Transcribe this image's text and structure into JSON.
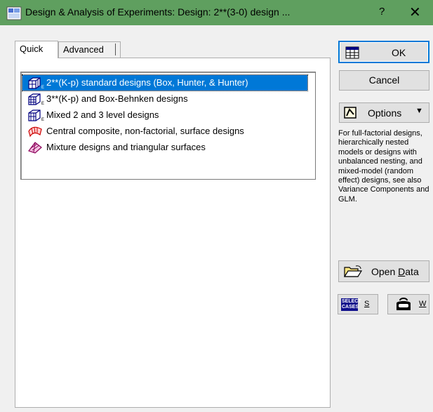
{
  "window": {
    "title": "Design & Analysis of Experiments: Design: 2**(3-0) design ...",
    "help": "?",
    "close": "✕"
  },
  "tabs": [
    {
      "label": "Quick",
      "active": true
    },
    {
      "label": "Advanced",
      "active": false
    }
  ],
  "design_list": {
    "selected_index": 0,
    "items": [
      {
        "label": "2**(K-p) standard designs (Box, Hunter, & Hunter)",
        "icon": "cube-grid-icon"
      },
      {
        "label": "3**(K-p) and Box-Behnken designs",
        "icon": "cube-grid-icon"
      },
      {
        "label": "Mixed 2 and 3 level designs",
        "icon": "cube-grid-icon"
      },
      {
        "label": "Central composite, non-factorial, surface designs",
        "icon": "surface-icon"
      },
      {
        "label": "Mixture designs and triangular surfaces",
        "icon": "triangle-surface-icon"
      }
    ]
  },
  "buttons": {
    "ok": "OK",
    "cancel": "Cancel",
    "options": "Options",
    "open_data_pre": "Open ",
    "open_data_u": "D",
    "open_data_post": "ata",
    "select_cases_icon_text": "SELECT CASES",
    "select_cases_key": "S",
    "weight_key": "W"
  },
  "info_text": "For full-factorial designs, hierarchically nested models or designs with unbalanced nesting, and mixed-model (random effect) designs, see also Variance Components and GLM.",
  "colors": {
    "titlebar": "#5f9f5f",
    "selection": "#0078d7",
    "accent_border": "#0078d7"
  }
}
